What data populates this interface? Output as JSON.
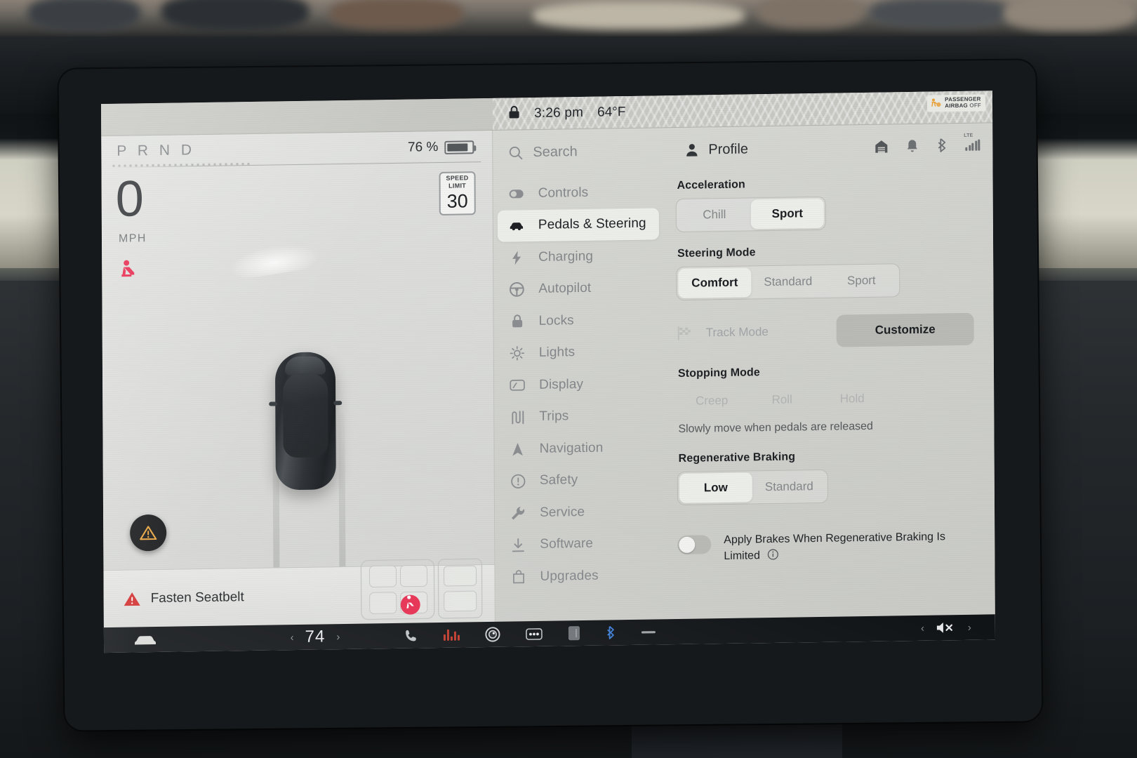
{
  "status_bar": {
    "lock_icon": "lock-icon",
    "time": "3:26 pm",
    "temperature": "64°F",
    "airbag_line1": "PASSENGER",
    "airbag_line2": "AIRBAG",
    "airbag_state": "OFF"
  },
  "drive_display": {
    "gear_indicator": "P R N D",
    "battery_percent": "76 %",
    "battery_level": 76,
    "speed": "0",
    "speed_unit": "MPH",
    "speed_limit_label_line1": "SPEED",
    "speed_limit_label_line2": "LIMIT",
    "speed_limit_value": "30",
    "alert_text": "Fasten Seatbelt",
    "warning_icon": "warning-triangle-icon",
    "seatbelt_icon": "seatbelt-warning-icon",
    "car_icon": "car-top-view"
  },
  "app_bar": {
    "search_placeholder": "Search",
    "search_icon": "search-icon",
    "profile_label": "Profile",
    "profile_icon": "person-icon",
    "icons": [
      "garage-home-icon",
      "bell-icon",
      "bluetooth-icon",
      "lte-signal-icon"
    ],
    "network_label": "LTE"
  },
  "sidebar": {
    "items": [
      {
        "label": "Controls",
        "icon": "toggle-icon",
        "active": false
      },
      {
        "label": "Pedals & Steering",
        "icon": "car-icon",
        "active": true
      },
      {
        "label": "Charging",
        "icon": "bolt-icon",
        "active": false
      },
      {
        "label": "Autopilot",
        "icon": "steering-wheel-icon",
        "active": false
      },
      {
        "label": "Locks",
        "icon": "lock-icon",
        "active": false
      },
      {
        "label": "Lights",
        "icon": "sun-icon",
        "active": false
      },
      {
        "label": "Display",
        "icon": "display-icon",
        "active": false
      },
      {
        "label": "Trips",
        "icon": "trips-icon",
        "active": false
      },
      {
        "label": "Navigation",
        "icon": "navigation-arrow-icon",
        "active": false
      },
      {
        "label": "Safety",
        "icon": "exclamation-circle-icon",
        "active": false
      },
      {
        "label": "Service",
        "icon": "wrench-icon",
        "active": false
      },
      {
        "label": "Software",
        "icon": "download-icon",
        "active": false
      },
      {
        "label": "Upgrades",
        "icon": "shopping-bag-icon",
        "active": false
      }
    ]
  },
  "settings": {
    "acceleration": {
      "title": "Acceleration",
      "options": [
        "Chill",
        "Sport"
      ],
      "selected": "Sport"
    },
    "steering_mode": {
      "title": "Steering Mode",
      "options": [
        "Comfort",
        "Standard",
        "Sport"
      ],
      "selected": "Comfort"
    },
    "track_mode": {
      "label": "Track Mode",
      "icon": "checkered-flag-icon",
      "customize_label": "Customize",
      "enabled": false
    },
    "stopping_mode": {
      "title": "Stopping Mode",
      "options": [
        "Creep",
        "Roll",
        "Hold"
      ],
      "selected": "Creep",
      "hint": "Slowly move when pedals are released"
    },
    "regenerative_braking": {
      "title": "Regenerative Braking",
      "options": [
        "Low",
        "Standard"
      ],
      "selected": "Low"
    },
    "apply_brakes_toggle": {
      "label": "Apply Brakes When Regenerative Braking Is Limited",
      "state": "off",
      "info_icon": "info-icon"
    }
  },
  "dock": {
    "car_icon": "car-icon",
    "climate_temp": "74",
    "chevron_left": "‹",
    "chevron_right": "›",
    "apps": [
      "phone-icon",
      "media-icon",
      "camera-icon",
      "more-dots-icon",
      "card-icon",
      "bluetooth-icon",
      "minimize-icon"
    ],
    "volume_icon": "volume-mute-icon"
  },
  "colors": {
    "screen_bg": "#d0d1cd",
    "panel_bg": "#c9cac6",
    "selected_pill": "#eceeea",
    "accent_dark": "#1f2225",
    "muted_text": "#84878a",
    "warn_red": "#d32f2f",
    "warn_amber": "#e8a33d",
    "customize_btn": "#b9bab6"
  }
}
